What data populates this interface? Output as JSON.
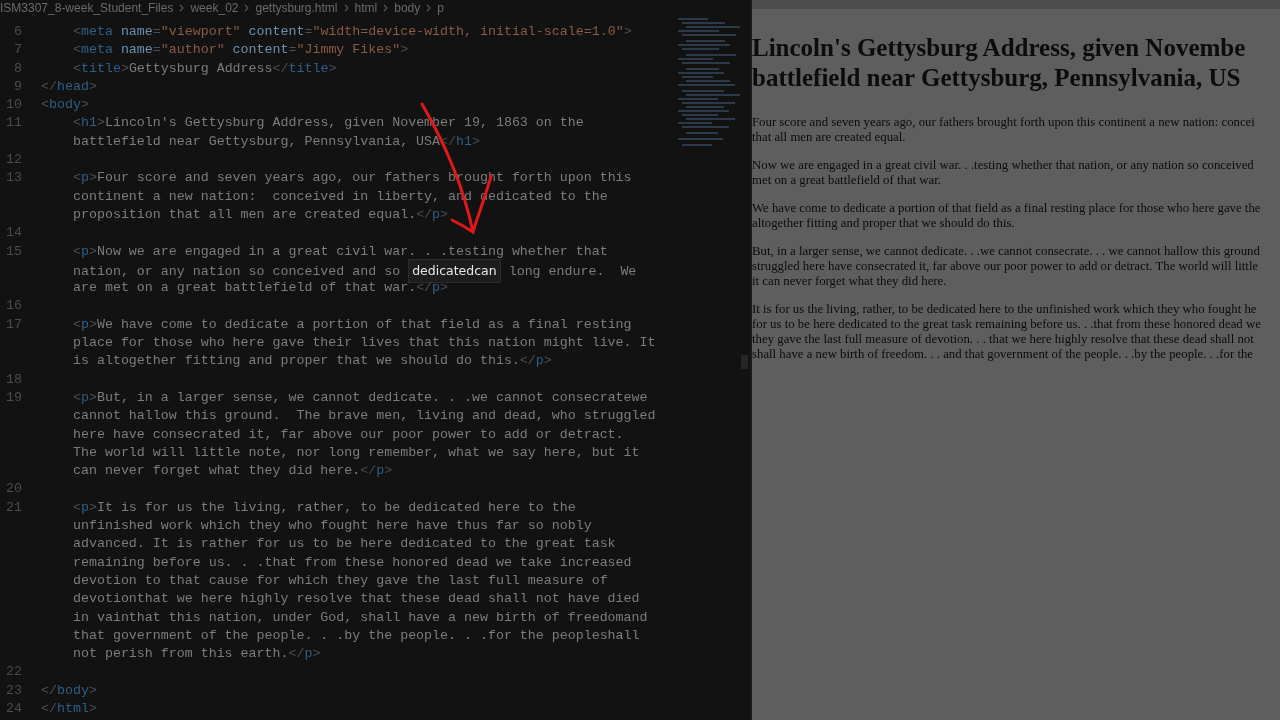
{
  "breadcrumb": [
    "ISM3307_8-week_Student_Files",
    "week_02",
    "gettysburg.html",
    "html",
    "body",
    "p"
  ],
  "editor": {
    "lines": [
      {
        "number": "6",
        "kind": "nested",
        "rows": [
          {
            "segments": [
              {
                "kind": "punct",
                "text": "<"
              },
              {
                "kind": "tag",
                "text": "meta"
              },
              {
                "kind": "attr",
                "text": " name"
              },
              {
                "kind": "punct",
                "text": "="
              },
              {
                "kind": "string",
                "text": "\"viewport\""
              },
              {
                "kind": "attr",
                "text": " content"
              },
              {
                "kind": "punct",
                "text": "="
              },
              {
                "kind": "string",
                "text": "\"width=device-width, initial-scale=1.0\""
              },
              {
                "kind": "punct",
                "text": ">"
              }
            ]
          }
        ]
      },
      {
        "number": "7",
        "kind": "nested",
        "rows": [
          {
            "segments": [
              {
                "kind": "punct",
                "text": "<"
              },
              {
                "kind": "tag",
                "text": "meta"
              },
              {
                "kind": "attr",
                "text": " name"
              },
              {
                "kind": "punct",
                "text": "="
              },
              {
                "kind": "string",
                "text": "\"author\""
              },
              {
                "kind": "attr",
                "text": " content"
              },
              {
                "kind": "punct",
                "text": "="
              },
              {
                "kind": "string",
                "text": "\"Jimmy Fikes\""
              },
              {
                "kind": "punct",
                "text": ">"
              }
            ]
          }
        ]
      },
      {
        "number": "8",
        "kind": "nested",
        "rows": [
          {
            "segments": [
              {
                "kind": "punct",
                "text": "<"
              },
              {
                "kind": "tag",
                "text": "title"
              },
              {
                "kind": "punct",
                "text": ">"
              },
              {
                "kind": "text",
                "text": "Gettysburg Address"
              },
              {
                "kind": "punct",
                "text": "</"
              },
              {
                "kind": "tag",
                "text": "title"
              },
              {
                "kind": "punct",
                "text": ">"
              }
            ]
          }
        ]
      },
      {
        "number": "9",
        "kind": "top",
        "rows": [
          {
            "segments": [
              {
                "kind": "punct",
                "text": "</"
              },
              {
                "kind": "tag",
                "text": "head"
              },
              {
                "kind": "punct",
                "text": ">"
              }
            ]
          }
        ]
      },
      {
        "number": "10",
        "kind": "top",
        "rows": [
          {
            "segments": [
              {
                "kind": "punct",
                "text": "<"
              },
              {
                "kind": "tag",
                "text": "body"
              },
              {
                "kind": "punct",
                "text": ">"
              }
            ]
          }
        ]
      },
      {
        "number": "11",
        "kind": "nested",
        "rows": [
          {
            "segments": [
              {
                "kind": "punct",
                "text": "<"
              },
              {
                "kind": "tag",
                "text": "h1"
              },
              {
                "kind": "punct",
                "text": ">"
              },
              {
                "kind": "text",
                "text": "Lincoln's Gettysburg Address, given November 19, 1863 on the"
              }
            ]
          },
          {
            "segments": [
              {
                "kind": "text",
                "text": "battlefield near Gettysburg, Pennsylvania, USA"
              },
              {
                "kind": "punct",
                "text": "</"
              },
              {
                "kind": "tag",
                "text": "h1"
              },
              {
                "kind": "punct",
                "text": ">"
              }
            ]
          }
        ]
      },
      {
        "number": "12",
        "kind": "top"
      },
      {
        "number": "13",
        "kind": "nested",
        "rows": [
          {
            "segments": [
              {
                "kind": "punct",
                "text": "<"
              },
              {
                "kind": "tag",
                "text": "p"
              },
              {
                "kind": "punct",
                "text": ">"
              },
              {
                "kind": "text",
                "text": "Four score and seven years ago, our fathers brought forth upon this"
              }
            ]
          },
          {
            "segments": [
              {
                "kind": "text",
                "text": "continent a new nation:  conceived in liberty, and dedicated to the"
              }
            ]
          },
          {
            "segments": [
              {
                "kind": "text",
                "text": "proposition that all men are created equal."
              },
              {
                "kind": "punct",
                "text": "</"
              },
              {
                "kind": "tag",
                "text": "p"
              },
              {
                "kind": "punct",
                "text": ">"
              }
            ]
          }
        ]
      },
      {
        "number": "14",
        "kind": "top"
      },
      {
        "number": "15",
        "kind": "nested",
        "rows": [
          {
            "segments": [
              {
                "kind": "punct",
                "text": "<"
              },
              {
                "kind": "tag",
                "text": "p"
              },
              {
                "kind": "punct",
                "text": ">"
              },
              {
                "kind": "text",
                "text": "Now we are engaged in a great civil war. . .testing whether that"
              }
            ]
          },
          {
            "segments": [
              {
                "kind": "text",
                "text": "nation, or any nation so conceived and so "
              },
              {
                "kind": "hover",
                "text": "dedicatedcan"
              },
              {
                "kind": "text",
                "text": " long endure.  We"
              }
            ]
          },
          {
            "segments": [
              {
                "kind": "text",
                "text": "are met on a great battlefield of that war."
              },
              {
                "kind": "punct",
                "text": "</"
              },
              {
                "kind": "tag",
                "text": "p"
              },
              {
                "kind": "punct",
                "text": ">"
              }
            ]
          }
        ]
      },
      {
        "number": "16",
        "kind": "top"
      },
      {
        "number": "17",
        "kind": "nested",
        "rows": [
          {
            "segments": [
              {
                "kind": "punct",
                "text": "<"
              },
              {
                "kind": "tag",
                "text": "p"
              },
              {
                "kind": "punct",
                "text": ">"
              },
              {
                "kind": "text",
                "text": "We have come to dedicate a portion of that field as a final resting"
              }
            ]
          },
          {
            "segments": [
              {
                "kind": "text",
                "text": "place for those who here gave their lives that this nation might live. It"
              }
            ]
          },
          {
            "segments": [
              {
                "kind": "text",
                "text": "is altogether fitting and proper that we should do this."
              },
              {
                "kind": "punct",
                "text": "</"
              },
              {
                "kind": "tag",
                "text": "p"
              },
              {
                "kind": "punct",
                "text": ">"
              }
            ]
          }
        ]
      },
      {
        "number": "18",
        "kind": "top"
      },
      {
        "number": "19",
        "kind": "nested",
        "rows": [
          {
            "segments": [
              {
                "kind": "punct",
                "text": "<"
              },
              {
                "kind": "tag",
                "text": "p"
              },
              {
                "kind": "punct",
                "text": ">"
              },
              {
                "kind": "text",
                "text": "But, in a larger sense, we cannot dedicate. . .we cannot consecratewe"
              }
            ]
          },
          {
            "segments": [
              {
                "kind": "text",
                "text": "cannot hallow this ground.  The brave men, living and dead, who struggled"
              }
            ]
          },
          {
            "segments": [
              {
                "kind": "text",
                "text": "here have consecrated it, far above our poor power to add or detract."
              }
            ]
          },
          {
            "segments": [
              {
                "kind": "text",
                "text": "The world will little note, nor long remember, what we say here, but it"
              }
            ]
          },
          {
            "segments": [
              {
                "kind": "text",
                "text": "can never forget what they did here."
              },
              {
                "kind": "punct",
                "text": "</"
              },
              {
                "kind": "tag",
                "text": "p"
              },
              {
                "kind": "punct",
                "text": ">"
              }
            ]
          }
        ]
      },
      {
        "number": "20",
        "kind": "top"
      },
      {
        "number": "21",
        "kind": "nested",
        "rows": [
          {
            "segments": [
              {
                "kind": "punct",
                "text": "<"
              },
              {
                "kind": "tag",
                "text": "p"
              },
              {
                "kind": "punct",
                "text": ">"
              },
              {
                "kind": "text",
                "text": "It is for us the living, rather, to be dedicated here to the"
              }
            ]
          },
          {
            "segments": [
              {
                "kind": "text",
                "text": "unfinished work which they who fought here have thus far so nobly"
              }
            ]
          },
          {
            "segments": [
              {
                "kind": "text",
                "text": "advanced. It is rather for us to be here dedicated to the great task"
              }
            ]
          },
          {
            "segments": [
              {
                "kind": "text",
                "text": "remaining before us. . .that from these honored dead we take increased"
              }
            ]
          },
          {
            "segments": [
              {
                "kind": "text",
                "text": "devotion to that cause for which they gave the last full measure of"
              }
            ]
          },
          {
            "segments": [
              {
                "kind": "text",
                "text": "devotionthat we here highly resolve that these dead shall not have died"
              }
            ]
          },
          {
            "segments": [
              {
                "kind": "text",
                "text": "in vainthat this nation, under God, shall have a new birth of freedomand"
              }
            ]
          },
          {
            "segments": [
              {
                "kind": "text",
                "text": "that government of the people. . .by the people. . .for the peopleshall"
              }
            ]
          },
          {
            "segments": [
              {
                "kind": "text",
                "text": "not perish from this earth."
              },
              {
                "kind": "punct",
                "text": "</"
              },
              {
                "kind": "tag",
                "text": "p"
              },
              {
                "kind": "punct",
                "text": ">"
              }
            ]
          }
        ]
      },
      {
        "number": "22",
        "kind": "top"
      },
      {
        "number": "23",
        "kind": "top",
        "rows": [
          {
            "segments": [
              {
                "kind": "punct",
                "text": "</"
              },
              {
                "kind": "tag",
                "text": "body"
              },
              {
                "kind": "punct",
                "text": ">"
              }
            ]
          }
        ]
      },
      {
        "number": "24",
        "kind": "top",
        "rows": [
          {
            "segments": [
              {
                "kind": "punct",
                "text": "</"
              },
              {
                "kind": "tag",
                "text": "html"
              },
              {
                "kind": "punct",
                "text": ">"
              }
            ]
          }
        ]
      }
    ]
  },
  "browser": {
    "blocks": [
      {
        "kind": "heading",
        "rows": [
          "Lincoln's Gettysburg Address, given Novembe",
          "battlefield near Gettysburg, Pennsylvania, US"
        ]
      },
      {
        "kind": "paragraph",
        "rows": [
          "Four score and seven years ago, our fathers brought forth upon this continent a new nation: concei",
          "that all men are created equal."
        ]
      },
      {
        "kind": "paragraph",
        "rows": [
          "Now we are engaged in a great civil war. . .testing whether that nation, or any nation so conceived",
          "met on a great battlefield of that war."
        ]
      },
      {
        "kind": "paragraph",
        "rows": [
          "We have come to dedicate a portion of that field as a final resting place for those who here gave the",
          "altogether fitting and proper that we should do this."
        ]
      },
      {
        "kind": "paragraph",
        "rows": [
          "But, in a larger sense, we cannot dedicate. . .we cannot consecrate. . . we cannot hallow this ground",
          "struggled here have consecrated it, far above our poor power to add or detract. The world will little",
          "it can never forget what they did here."
        ]
      },
      {
        "kind": "paragraph",
        "rows": [
          "It is for us the living, rather, to be dedicated here to the unfinished work which they who fought he",
          "for us to be here dedicated to the great task remaining before us. . .that from these honored dead we",
          "they gave the last full measure of devotion. . . that we here highly resolve that these dead shall not",
          "shall have a new birth of freedom. . . and that government of the people. . .by the people. . .for the"
        ]
      }
    ]
  }
}
